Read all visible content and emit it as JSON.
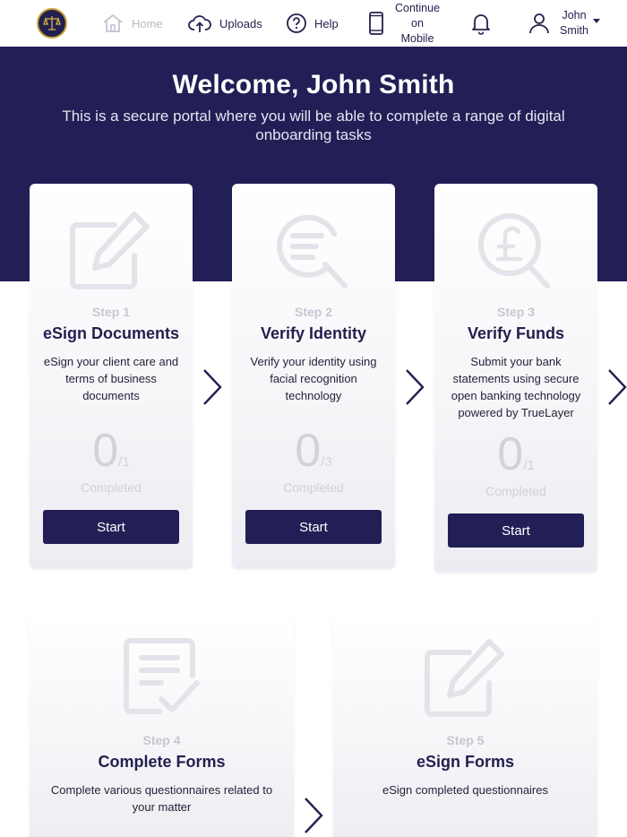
{
  "nav": {
    "home": "Home",
    "uploads": "Uploads",
    "help": "Help",
    "mobile_line1": "Continue",
    "mobile_line2": "on",
    "mobile_line3": "Mobile",
    "user_first": "John",
    "user_last": "Smith"
  },
  "hero": {
    "title": "Welcome, John Smith",
    "subtitle": "This is a secure portal where you will be able to complete a range of digital onboarding tasks"
  },
  "steps": [
    {
      "step": "Step 1",
      "title": "eSign Documents",
      "description": "eSign your client care and terms of business documents",
      "completed_count": "0",
      "total": "/1",
      "completed_label": "Completed",
      "button": "Start",
      "icon": "edit-document-icon"
    },
    {
      "step": "Step 2",
      "title": "Verify Identity",
      "description": "Verify your identity using facial recognition technology",
      "completed_count": "0",
      "total": "/3",
      "completed_label": "Completed",
      "button": "Start",
      "icon": "search-identity-icon"
    },
    {
      "step": "Step 3",
      "title": "Verify Funds",
      "description": "Submit your bank statements using secure open banking technology powered by TrueLayer",
      "completed_count": "0",
      "total": "/1",
      "completed_label": "Completed",
      "button": "Start",
      "icon": "pound-search-icon"
    },
    {
      "step": "Step 4",
      "title": "Complete Forms",
      "description": "Complete various questionnaires related to your matter",
      "icon": "form-check-icon"
    },
    {
      "step": "Step 5",
      "title": "eSign Forms",
      "description": "eSign completed questionnaires",
      "icon": "edit-document-icon"
    }
  ],
  "colors": {
    "brand_navy": "#221f56",
    "muted_text": "#c7c7d3",
    "logo_gold": "#c9a33a"
  }
}
